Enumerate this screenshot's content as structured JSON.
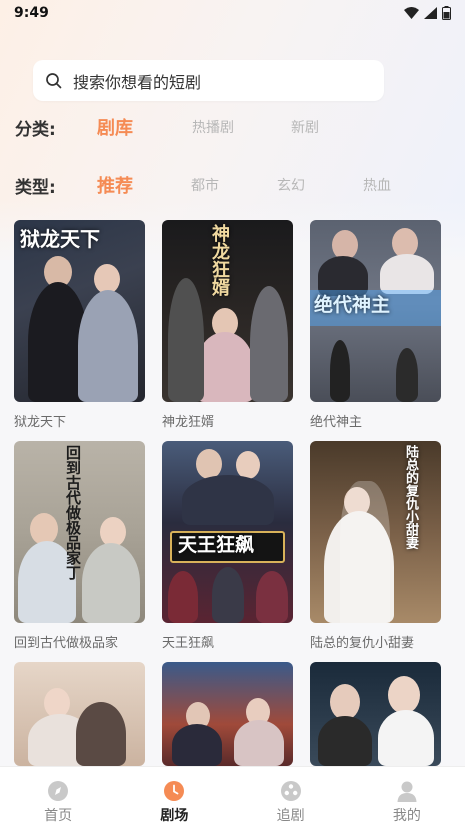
{
  "status_bar": {
    "time": "9:49"
  },
  "search": {
    "placeholder": "搜索你想看的短剧"
  },
  "filters": {
    "category": {
      "label": "分类:",
      "options": [
        "剧库",
        "热播剧",
        "新剧"
      ],
      "active": 0
    },
    "genre": {
      "label": "类型:",
      "options": [
        "推荐",
        "都市",
        "玄幻",
        "热血"
      ],
      "active": 0
    }
  },
  "dramas": [
    {
      "title": "狱龙天下",
      "poster_text": "狱龙天下"
    },
    {
      "title": "神龙狂婿",
      "poster_text": "神龙狂婿"
    },
    {
      "title": "绝代神主",
      "poster_text": "绝代神主"
    },
    {
      "title": "回到古代做极品家",
      "poster_text": "回到古代做极品家丁"
    },
    {
      "title": "天王狂飙",
      "poster_text": "天王狂飙"
    },
    {
      "title": "陆总的复仇小甜妻",
      "poster_text": "陆总的复仇小甜妻"
    },
    {
      "title": ""
    },
    {
      "title": ""
    },
    {
      "title": ""
    }
  ],
  "tabbar": {
    "items": [
      {
        "label": "首页",
        "icon": "compass-icon"
      },
      {
        "label": "剧场",
        "icon": "clock-icon"
      },
      {
        "label": "追剧",
        "icon": "film-reel-icon"
      },
      {
        "label": "我的",
        "icon": "user-icon"
      }
    ],
    "active": 1
  },
  "colors": {
    "accent": "#f58b54",
    "inactive": "#b7b7b7",
    "tab_inactive_icon": "#c9c9c9"
  }
}
